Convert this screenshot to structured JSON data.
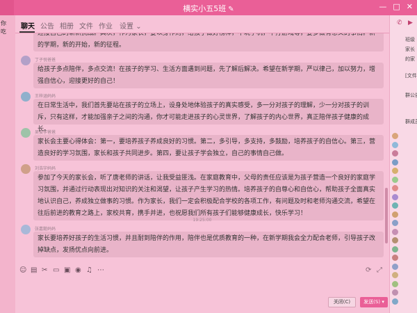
{
  "window": {
    "title": "横实小五5班",
    "left_fragment": "",
    "controls": [
      "—",
      "□",
      "✕"
    ]
  },
  "left_strip": [
    "你",
    "吃"
  ],
  "tabs": [
    {
      "label": "聊天",
      "active": true
    },
    {
      "label": "公告",
      "active": false
    },
    {
      "label": "相册",
      "active": false
    },
    {
      "label": "文件",
      "active": false
    },
    {
      "label": "作业",
      "active": false
    },
    {
      "label": "设置",
      "active": false
    }
  ],
  "messages": [
    {
      "sender": "",
      "text": "迎接自己的崭新挑战。其次，作为家长，要以身作则，给孩子做好榜样，不玩手机，不打游戏等，要多做有意义的事情。新的学期，新的开始，新的征程。",
      "partial_top": true
    },
    {
      "sender": "丁子悦爸爸",
      "text": "给孩子多点陪伴，多点交流！在孩子的学习、生活方面遇到问题，先了解后解决。希望在新学期，严以律己，加以努力，增强自信心，迎接更好的自己！"
    },
    {
      "sender": "王梓涵妈妈",
      "text": "在日常生活中，我们首先要站在孩子的立场上，设身处地体验孩子的真实感受，多一分对孩子的理解，少一分对孩子的训斥，只有这样，才能加强亲子之间的沟通，你才可能走进孩子的心灵世界，了解孩子的内心世界，真正陪伴孩子健康的成长。"
    },
    {
      "sender": "吴俊宇爸爸",
      "text": "家长会主要心得体会：第一，要培养孩子养成良好的习惯。第二，多引导，多支持，多鼓励，培养孩子的自信心。第三，营造良好的学习氛围，家长和孩子共同进步。第四，要让孩子学会独立，自己的事情自己做。"
    },
    {
      "sender": "刘浩宇妈妈",
      "text": "参加了今天的家长会，听了唐老师的讲话，让我受益匪浅。在家庭教育中，父母的责任应该是为孩子营造一个良好的家庭学习氛围，并通过行动表现出对知识的关注和渴望，让孩子产生学习的热情。培养孩子的自尊心和自信心，帮助孩子全面真实地认识自己，养成独立做事的习惯。作为家长，我们一定会积极配合学校的各项工作，有问题及时和老师沟通交流，希望在往后前进的教育之路上，家校共育，携手并进，也祝愿我们所有孩子们能够健康成长，快乐学习！"
    },
    {
      "timestamp": "19:25:00"
    },
    {
      "sender": "张嘉懿妈妈",
      "text": "家长要培养好孩子的生活习惯，并且耐到陪伴的作用，陪伴也是优质教育的一种，在新学期我会全力配合老师，引导孩子改掉缺点，发扬优点向前进。"
    }
  ],
  "toolbar": {
    "left_icons": [
      "smiley-icon",
      "image-icon",
      "scissors-icon",
      "folder-icon",
      "picture-icon",
      "mic-icon",
      "bell-icon",
      "more-icon"
    ],
    "right_icons": [
      "expand-icon",
      "history-icon"
    ]
  },
  "input": {
    "close_label": "关闭(C)",
    "send_label": "发送(S)",
    "send_dropdown": "▾"
  },
  "right_panel": {
    "top_icons": [
      "phone-icon",
      "video-icon"
    ],
    "lines": [
      "班级",
      "家长",
      "的家",
      "[文件]",
      "群公告",
      "群成员"
    ],
    "members_count": "",
    "member_colors": [
      "#d9a57a",
      "#8fb9d9",
      "#c97c9a",
      "#7a9cc6",
      "#d6b06d",
      "#9acb8e",
      "#e08b8b",
      "#a98bd0",
      "#6fb3b3",
      "#d0a070",
      "#8aa0c8",
      "#c68fb3",
      "#b39070",
      "#7fb58f",
      "#c98080",
      "#8f9fc8",
      "#d0b080",
      "#a0c080",
      "#c090b0",
      "#80a8c8"
    ]
  },
  "colors": {
    "accent": "#ea5f97",
    "background": "#f7c3d8",
    "bubble": "#e9b4c9"
  }
}
